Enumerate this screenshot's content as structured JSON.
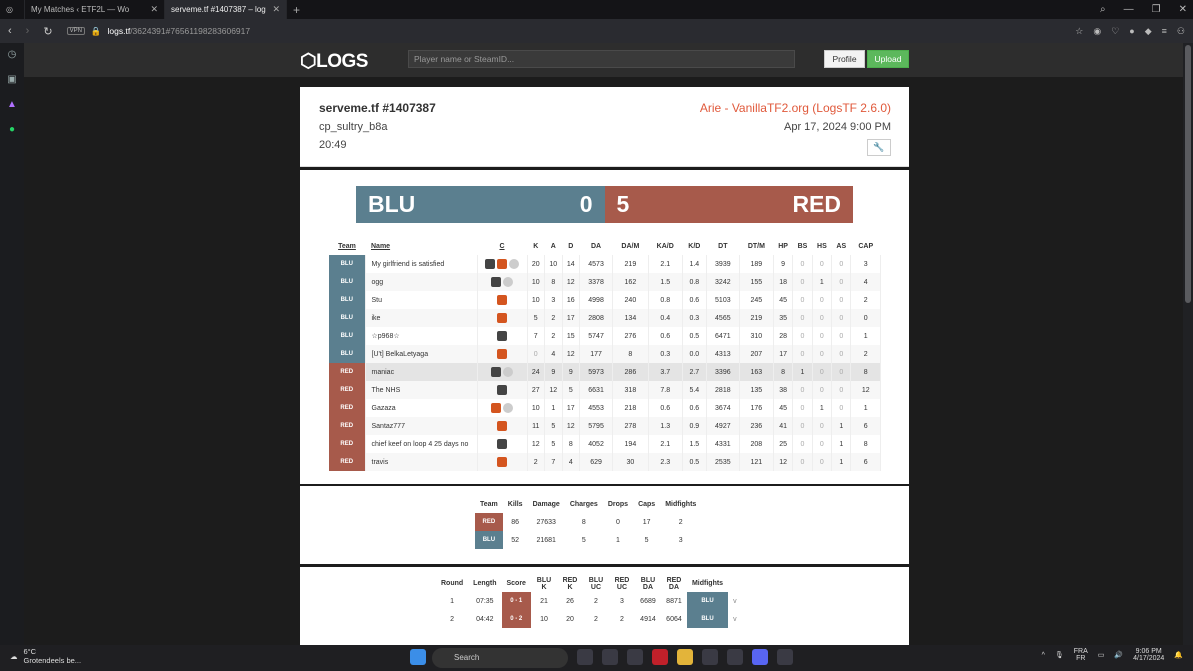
{
  "browser": {
    "tabs": [
      {
        "label": "My Matches ‹ ETF2L — Wo"
      },
      {
        "label": "serveme.tf #1407387 – log"
      }
    ],
    "url_host": "logs.tf",
    "url_path": "/3624391#76561198283606917",
    "vpn": "VPN"
  },
  "site": {
    "logo": "LOGS",
    "search_placeholder": "Player name or SteamID...",
    "profile": "Profile",
    "upload": "Upload"
  },
  "log": {
    "title": "serveme.tf #1407387",
    "map": "cp_sultry_b8a",
    "length": "20:49",
    "uploader": "Arie - VanillaTF2.org (LogsTF 2.6.0)",
    "date": "Apr 17, 2024 9:00 PM",
    "blu_name": "BLU",
    "blu_score": "0",
    "red_name": "RED",
    "red_score": "5"
  },
  "colors": {
    "blu": "#5b7f8f",
    "red": "#a75a4b",
    "upload": "#5cb85c",
    "accent": "#e0593b"
  },
  "stats_headers": [
    "Team",
    "Name",
    "C",
    "K",
    "A",
    "D",
    "DA",
    "DA/M",
    "KA/D",
    "K/D",
    "DT",
    "DT/M",
    "HP",
    "BS",
    "HS",
    "AS",
    "CAP"
  ],
  "players": [
    {
      "team": "BLU",
      "name": "My girlfriend is satisfied",
      "k": "20",
      "a": "10",
      "d": "14",
      "da": "4573",
      "dam": "219",
      "kad": "2.1",
      "kd": "1.4",
      "dt": "3939",
      "dtm": "189",
      "hp": "9",
      "bs": "0",
      "hs": "0",
      "as": "0",
      "cap": "3"
    },
    {
      "team": "BLU",
      "name": "ogg",
      "k": "10",
      "a": "8",
      "d": "12",
      "da": "3378",
      "dam": "162",
      "kad": "1.5",
      "kd": "0.8",
      "dt": "3242",
      "dtm": "155",
      "hp": "18",
      "bs": "0",
      "hs": "1",
      "as": "0",
      "cap": "4"
    },
    {
      "team": "BLU",
      "name": "Stu",
      "k": "10",
      "a": "3",
      "d": "16",
      "da": "4998",
      "dam": "240",
      "kad": "0.8",
      "kd": "0.6",
      "dt": "5103",
      "dtm": "245",
      "hp": "45",
      "bs": "0",
      "hs": "0",
      "as": "0",
      "cap": "2"
    },
    {
      "team": "BLU",
      "name": "ike",
      "k": "5",
      "a": "2",
      "d": "17",
      "da": "2808",
      "dam": "134",
      "kad": "0.4",
      "kd": "0.3",
      "dt": "4565",
      "dtm": "219",
      "hp": "35",
      "bs": "0",
      "hs": "0",
      "as": "0",
      "cap": "0"
    },
    {
      "team": "BLU",
      "name": "☆p968☆",
      "k": "7",
      "a": "2",
      "d": "15",
      "da": "5747",
      "dam": "276",
      "kad": "0.6",
      "kd": "0.5",
      "dt": "6471",
      "dtm": "310",
      "hp": "28",
      "bs": "0",
      "hs": "0",
      "as": "0",
      "cap": "1"
    },
    {
      "team": "BLU",
      "name": "[U't] BelkaLetyaga",
      "k": "0",
      "a": "4",
      "d": "12",
      "da": "177",
      "dam": "8",
      "kad": "0.3",
      "kd": "0.0",
      "dt": "4313",
      "dtm": "207",
      "hp": "17",
      "bs": "0",
      "hs": "0",
      "as": "0",
      "cap": "2"
    },
    {
      "team": "RED",
      "name": "maniac",
      "k": "24",
      "a": "9",
      "d": "9",
      "da": "5973",
      "dam": "286",
      "kad": "3.7",
      "kd": "2.7",
      "dt": "3396",
      "dtm": "163",
      "hp": "8",
      "bs": "1",
      "hs": "0",
      "as": "0",
      "cap": "8"
    },
    {
      "team": "RED",
      "name": "The NHS",
      "k": "27",
      "a": "12",
      "d": "5",
      "da": "6631",
      "dam": "318",
      "kad": "7.8",
      "kd": "5.4",
      "dt": "2818",
      "dtm": "135",
      "hp": "38",
      "bs": "0",
      "hs": "0",
      "as": "0",
      "cap": "12"
    },
    {
      "team": "RED",
      "name": "Gazaza",
      "k": "10",
      "a": "1",
      "d": "17",
      "da": "4553",
      "dam": "218",
      "kad": "0.6",
      "kd": "0.6",
      "dt": "3674",
      "dtm": "176",
      "hp": "45",
      "bs": "0",
      "hs": "1",
      "as": "0",
      "cap": "1"
    },
    {
      "team": "RED",
      "name": "Santaz777",
      "k": "11",
      "a": "5",
      "d": "12",
      "da": "5795",
      "dam": "278",
      "kad": "1.3",
      "kd": "0.9",
      "dt": "4927",
      "dtm": "236",
      "hp": "41",
      "bs": "0",
      "hs": "0",
      "as": "1",
      "cap": "6"
    },
    {
      "team": "RED",
      "name": "chief keef on loop 4 25 days no",
      "k": "12",
      "a": "5",
      "d": "8",
      "da": "4052",
      "dam": "194",
      "kad": "2.1",
      "kd": "1.5",
      "dt": "4331",
      "dtm": "208",
      "hp": "25",
      "bs": "0",
      "hs": "0",
      "as": "1",
      "cap": "8"
    },
    {
      "team": "RED",
      "name": "travis",
      "k": "2",
      "a": "7",
      "d": "4",
      "da": "629",
      "dam": "30",
      "kad": "2.3",
      "kd": "0.5",
      "dt": "2535",
      "dtm": "121",
      "hp": "12",
      "bs": "0",
      "hs": "0",
      "as": "1",
      "cap": "6"
    }
  ],
  "team_headers": [
    "Team",
    "Kills",
    "Damage",
    "Charges",
    "Drops",
    "Caps",
    "Midfights"
  ],
  "team_rows": [
    {
      "team": "RED",
      "kills": "86",
      "damage": "27633",
      "charges": "8",
      "drops": "0",
      "caps": "17",
      "mid": "2"
    },
    {
      "team": "BLU",
      "kills": "52",
      "damage": "21681",
      "charges": "5",
      "drops": "1",
      "caps": "5",
      "mid": "3"
    }
  ],
  "round_headers": [
    "Round",
    "Length",
    "Score",
    "BLU K",
    "RED K",
    "BLU UC",
    "RED UC",
    "BLU DA",
    "RED DA",
    "Midfights"
  ],
  "rounds": [
    {
      "round": "1",
      "len": "07:35",
      "score": "0 - 1",
      "bk": "21",
      "rk": "26",
      "buc": "2",
      "ruc": "3",
      "bda": "6689",
      "rda": "8871",
      "mid": "BLU"
    },
    {
      "round": "2",
      "len": "04:42",
      "score": "0 - 2",
      "bk": "10",
      "rk": "20",
      "buc": "2",
      "ruc": "2",
      "bda": "4914",
      "rda": "6064",
      "mid": "BLU"
    }
  ],
  "taskbar": {
    "temp": "6°C",
    "weather": "Grotendeels be...",
    "search": "Search",
    "lang1": "FRA",
    "lang2": "FR",
    "time": "9:06 PM",
    "date": "4/17/2024"
  }
}
